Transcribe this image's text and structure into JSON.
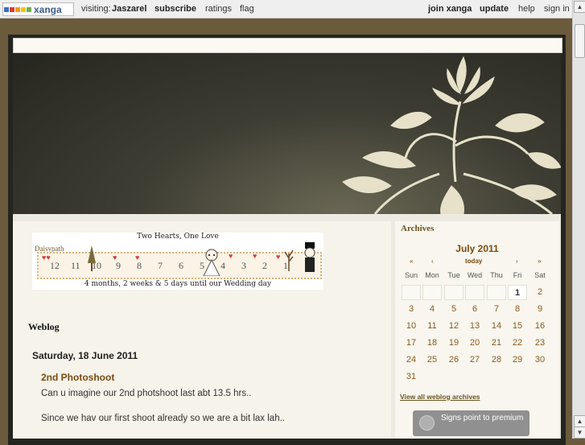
{
  "topbar": {
    "logo_text": "xanga",
    "visiting_label": "visiting:",
    "visiting_user": "Jaszarel",
    "subscribe": "subscribe",
    "ratings": "ratings",
    "flag": "flag",
    "join": "join xanga",
    "update": "update",
    "help": "help",
    "signin": "sign in"
  },
  "ticker": {
    "title": "Two Hearts, One Love",
    "tag": "Daisypath",
    "numbers": [
      "12",
      "11",
      "10",
      "9",
      "8",
      "7",
      "6",
      "5",
      "4",
      "3",
      "2",
      "1"
    ],
    "caption": "4 months, 2 weeks & 5 days until our Wedding day"
  },
  "weblog": {
    "heading": "Weblog",
    "date": "Saturday, 18 June 2011",
    "post_title": "2nd Photoshoot",
    "paragraphs": [
      "Can u imagine our 2nd photshoot last abt 13.5 hrs..",
      "Since we hav our first shoot already so we are a bit lax lah.."
    ]
  },
  "sidebar": {
    "archives_heading": "Archives",
    "month": "July 2011",
    "nav": {
      "first": "«",
      "prev": "‹",
      "today": "today",
      "next": "›",
      "last": "»"
    },
    "weekdays": [
      "Sun",
      "Mon",
      "Tue",
      "Wed",
      "Thu",
      "Fri",
      "Sat"
    ],
    "days": [
      "1",
      "2",
      "3",
      "4",
      "5",
      "6",
      "7",
      "8",
      "9",
      "10",
      "11",
      "12",
      "13",
      "14",
      "15",
      "16",
      "17",
      "18",
      "19",
      "20",
      "21",
      "22",
      "23",
      "24",
      "25",
      "26",
      "27",
      "28",
      "29",
      "30",
      "31"
    ],
    "view_all": "View all weblog archives",
    "premium": "Signs point to premium"
  },
  "colors": {
    "accent": "#7a4a10",
    "frame": "#252520",
    "background": "#6b5a3c"
  }
}
